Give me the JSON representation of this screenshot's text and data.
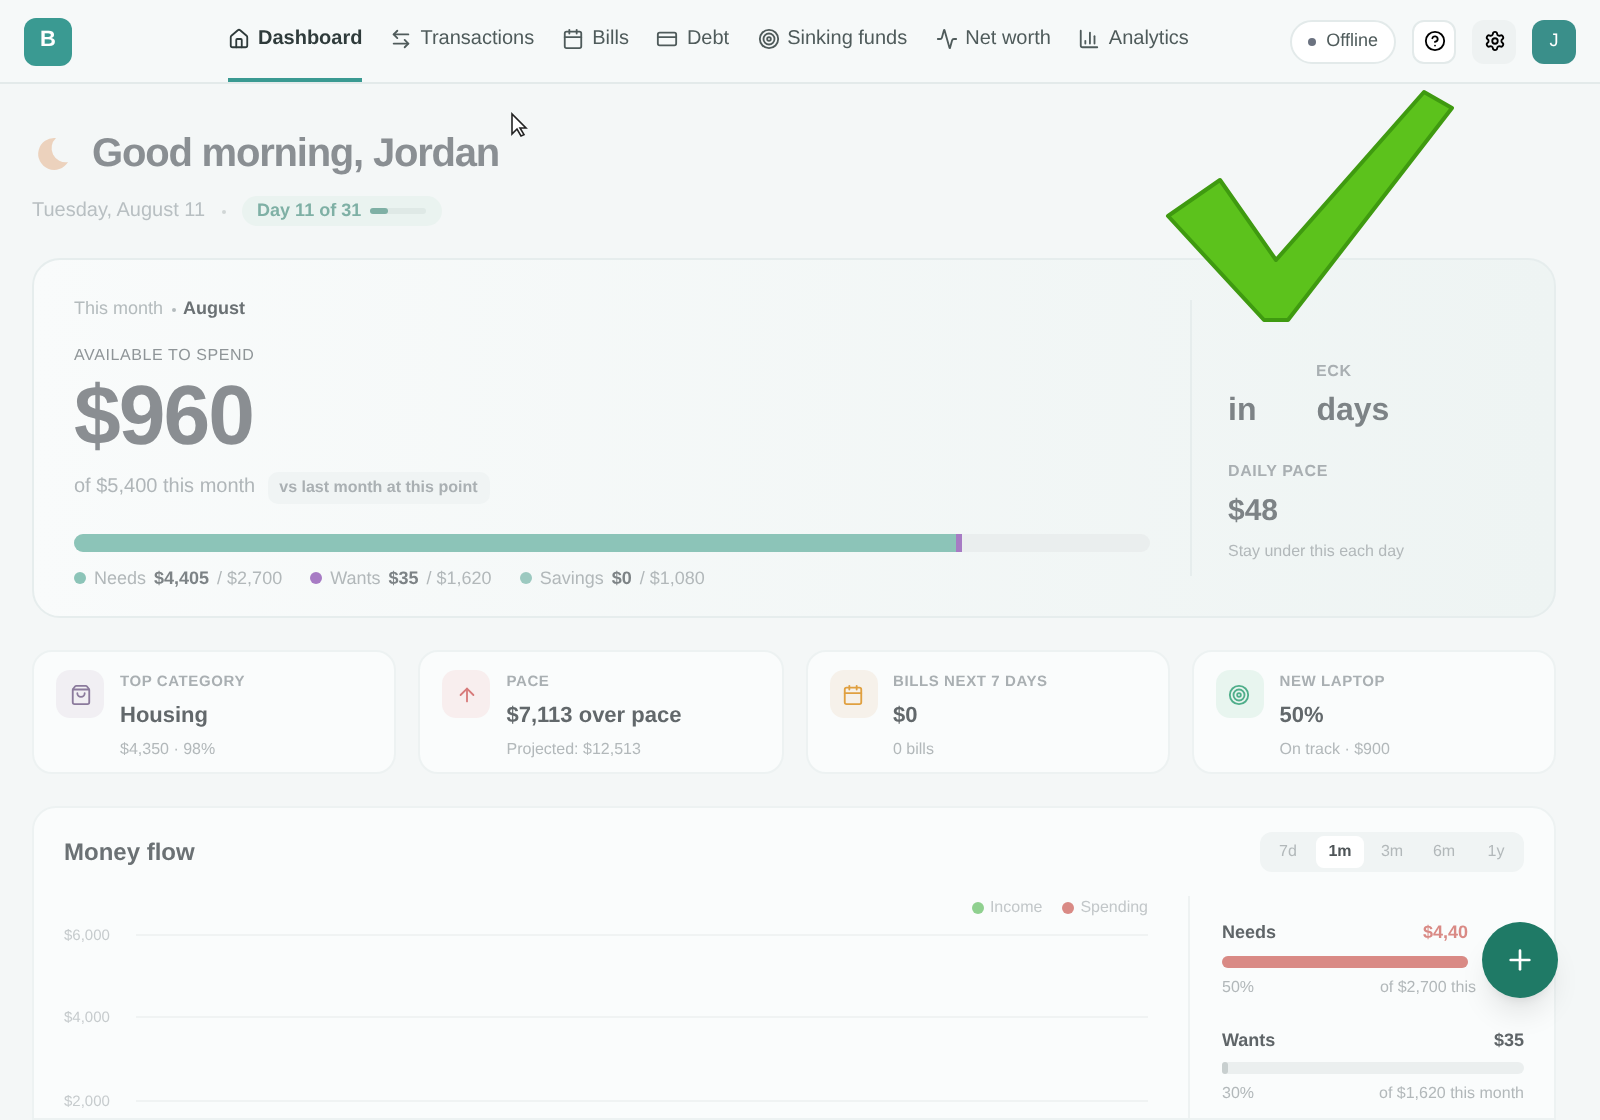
{
  "header": {
    "logo": "B",
    "nav": [
      {
        "label": "Dashboard",
        "selected": true
      },
      {
        "label": "Transactions",
        "selected": false
      },
      {
        "label": "Bills",
        "selected": false
      },
      {
        "label": "Debt",
        "selected": false
      },
      {
        "label": "Sinking funds",
        "selected": false
      },
      {
        "label": "Net worth",
        "selected": false
      },
      {
        "label": "Analytics",
        "selected": false
      }
    ],
    "status": "Offline",
    "avatar": "J"
  },
  "greeting": {
    "title": "Good morning, Jordan",
    "date": "Tuesday, August 11",
    "day_pill": {
      "label": "Day 11 of 31",
      "level": 0.35
    }
  },
  "hero": {
    "period_label": "This month",
    "period": "August",
    "available_label": "AVAILABLE TO SPEND",
    "amount": "$960",
    "of_text": "of $5,400 this month",
    "compare_chip": "vs last month at this point",
    "segments": [
      {
        "name": "Needs",
        "value": "$4,405",
        "limit": "/ $2,700",
        "level": 0.82,
        "color": "#8cc4b8"
      },
      {
        "name": "Wants",
        "value": "$35",
        "limit": "/ $1,620",
        "level": 0.006,
        "color": "#a77bc4"
      },
      {
        "name": "Savings",
        "value": "$0",
        "limit": "/ $1,080",
        "color": "#9cc9c0"
      }
    ],
    "paycheck_label": "ECK",
    "paycheck_value": [
      "in",
      "days"
    ],
    "daily_label": "DAILY PACE",
    "daily_value": "$48",
    "daily_note": "Stay under this each day"
  },
  "stats": [
    {
      "label": "TOP CATEGORY",
      "value": "Housing",
      "note": "$4,350 · 98%"
    },
    {
      "label": "PACE",
      "value": "$7,113 over pace",
      "note": "Projected: $12,513"
    },
    {
      "label": "BILLS NEXT 7 DAYS",
      "value": "$0",
      "note": "0 bills"
    },
    {
      "label": "NEW LAPTOP",
      "value": "50%",
      "note": "On track · $900"
    }
  ],
  "money_flow": {
    "title": "Money flow",
    "ranges": [
      {
        "label": "7d",
        "selected": false
      },
      {
        "label": "1m",
        "selected": true
      },
      {
        "label": "3m",
        "selected": false
      },
      {
        "label": "6m",
        "selected": false
      },
      {
        "label": "1y",
        "selected": false
      }
    ],
    "legend": [
      {
        "label": "Income",
        "color": "#8fd08f"
      },
      {
        "label": "Spending",
        "color": "#d98a85"
      }
    ],
    "y_ticks": [
      "$6,000",
      "$4,000",
      "$2,000"
    ],
    "budgets": [
      {
        "name": "Needs",
        "amount": "$4,40",
        "level": 1,
        "over": true,
        "percent": "50%",
        "of_text": "of $2,700 this"
      },
      {
        "name": "Wants",
        "amount": "$35",
        "level": 0.02,
        "over": false,
        "percent": "30%",
        "of_text": "of $1,620 this month"
      }
    ]
  }
}
